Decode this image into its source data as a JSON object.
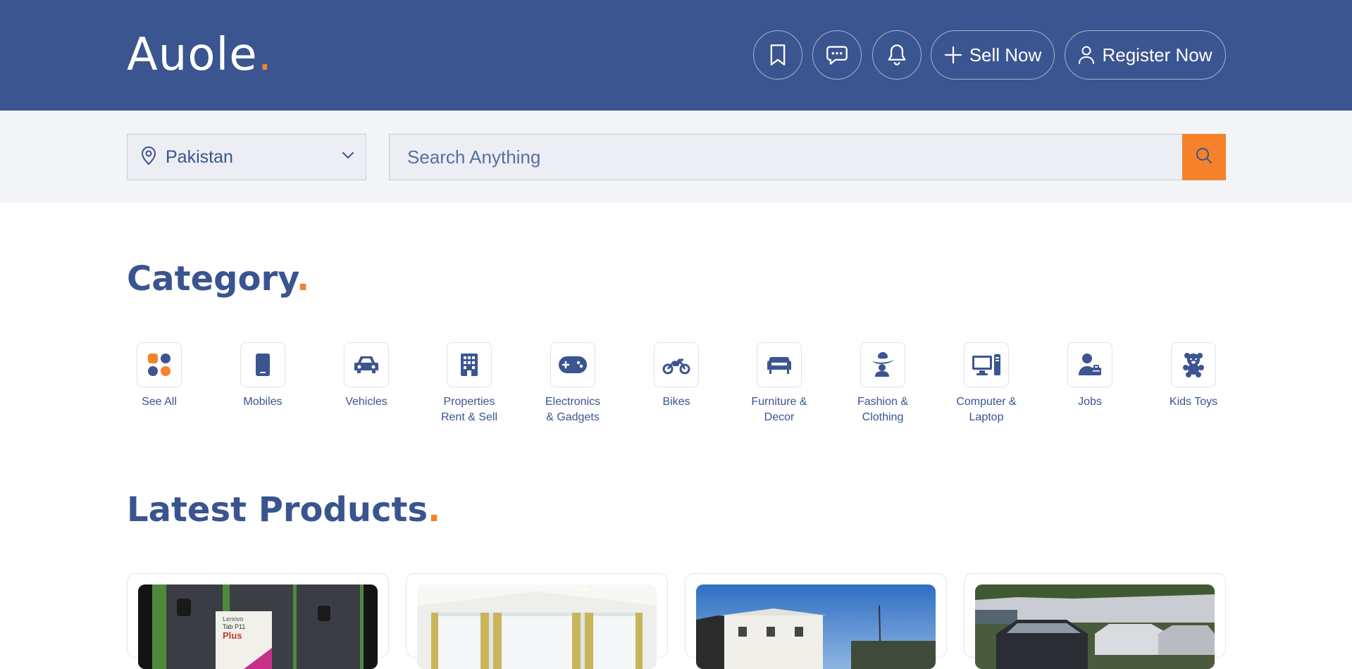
{
  "header": {
    "logo_text": "Auole",
    "logo_dot": ".",
    "sell_label": "Sell Now",
    "register_label": "Register Now"
  },
  "search": {
    "location": "Pakistan",
    "placeholder": "Search Anything"
  },
  "category": {
    "title": "Category",
    "dot": ".",
    "items": [
      {
        "label": "See All",
        "icon": "grid-icon"
      },
      {
        "label": "Mobiles",
        "icon": "mobile-icon"
      },
      {
        "label": "Vehicles",
        "icon": "car-icon"
      },
      {
        "label": "Properties\nRent & Sell",
        "icon": "building-icon"
      },
      {
        "label": "Electronics\n& Gadgets",
        "icon": "gamepad-icon"
      },
      {
        "label": "Bikes",
        "icon": "motorcycle-icon"
      },
      {
        "label": "Furniture &\nDecor",
        "icon": "armchair-icon"
      },
      {
        "label": "Fashion &\nClothing",
        "icon": "hat-icon"
      },
      {
        "label": "Computer &\nLaptop",
        "icon": "desktop-icon"
      },
      {
        "label": "Jobs",
        "icon": "user-tie-icon"
      },
      {
        "label": "Kids Toys",
        "icon": "teddy-bear-icon"
      }
    ]
  },
  "latest": {
    "title": "Latest Products",
    "dot": ".",
    "products": [
      {
        "image": "tablet-product-image",
        "image_text": [
          "Lenovo",
          "Tab P11",
          "Plus"
        ]
      },
      {
        "image": "caravan-interior-image"
      },
      {
        "image": "mobile-home-image"
      },
      {
        "image": "car-lot-image"
      }
    ]
  },
  "colors": {
    "primary": "#3b5591",
    "accent": "#f5822a",
    "search_bg": "#f3f4f8"
  }
}
